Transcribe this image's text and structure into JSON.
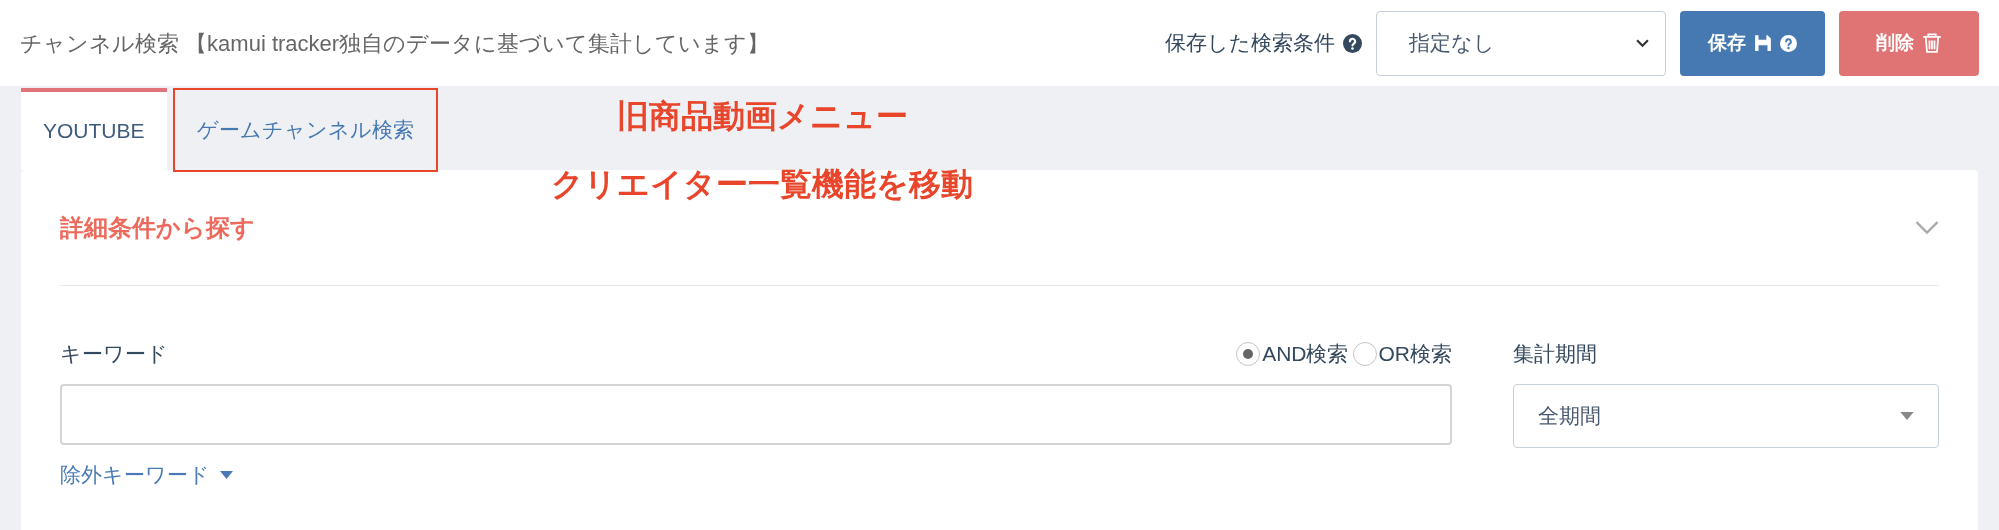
{
  "header": {
    "title": "チャンネル検索 【kamui tracker独自のデータに基づいて集計しています】",
    "saved_label": "保存した検索条件",
    "saved_select": {
      "value": "指定なし"
    },
    "buttons": [
      {
        "kind": "save",
        "label": "保存"
      },
      {
        "kind": "delete",
        "label": "削除"
      }
    ]
  },
  "tabs": [
    {
      "label": "YOUTUBE",
      "selected": true,
      "highlighted": false
    },
    {
      "label": "ゲームチャンネル検索",
      "selected": false,
      "highlighted": true
    }
  ],
  "annotation": [
    "旧商品動画メニュー",
    "クリエイター一覧機能を移動"
  ],
  "panel": {
    "title": "詳細条件から探す",
    "expanded": true,
    "keyword": {
      "label": "キーワード",
      "modes": [
        {
          "label": "AND検索",
          "selected": true
        },
        {
          "label": "OR検索",
          "selected": false
        }
      ],
      "exclude_link": "除外キーワード"
    },
    "period": {
      "label": "集計期間",
      "value": "全期間"
    }
  }
}
